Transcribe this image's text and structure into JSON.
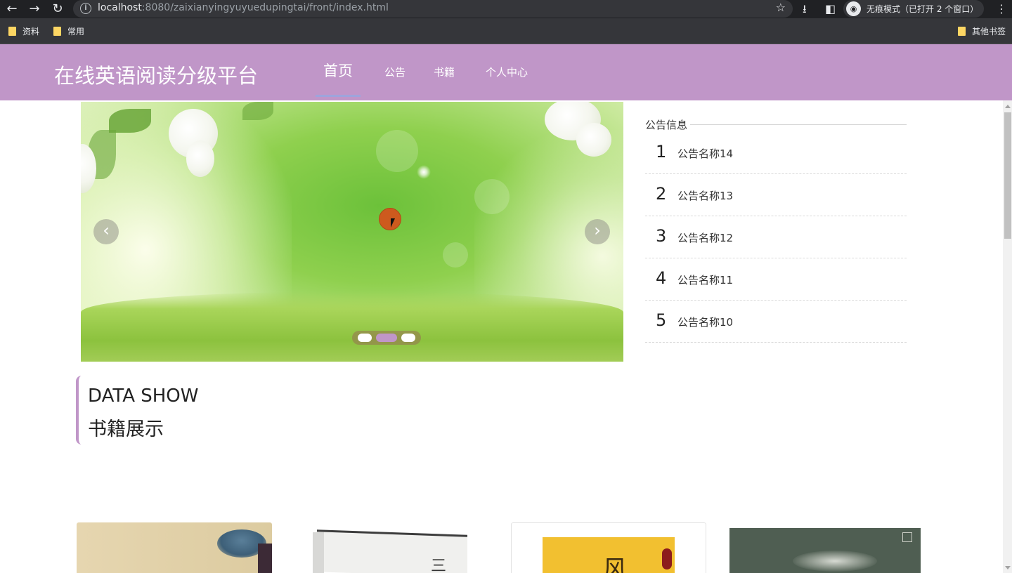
{
  "browser": {
    "url_host": "localhost",
    "url_path": ":8080/zaixianyingyuyuedupingtai/front/index.html",
    "incognito_label": "无痕模式（已打开 2 个窗口）",
    "bookmarks": [
      "资料",
      "常用"
    ],
    "other_bookmarks": "其他书签"
  },
  "header": {
    "site_title": "在线英语阅读分级平台",
    "nav": [
      "首页",
      "公告",
      "书籍",
      "个人中心"
    ],
    "active_nav": "首页",
    "brand_color": "#c096c8"
  },
  "carousel": {
    "prev_icon": "‹",
    "next_icon": "›",
    "slide_count": 3,
    "active_slide": 2
  },
  "notices": {
    "title": "公告信息",
    "items": [
      {
        "num": "1",
        "name": "公告名称14"
      },
      {
        "num": "2",
        "name": "公告名称13"
      },
      {
        "num": "3",
        "name": "公告名称12"
      },
      {
        "num": "4",
        "name": "公告名称11"
      },
      {
        "num": "5",
        "name": "公告名称10"
      }
    ]
  },
  "section": {
    "en": "DATA SHOW",
    "cn": "书籍展示"
  },
  "books": {
    "book2_glyph": "三",
    "book3_glyph": "风"
  }
}
